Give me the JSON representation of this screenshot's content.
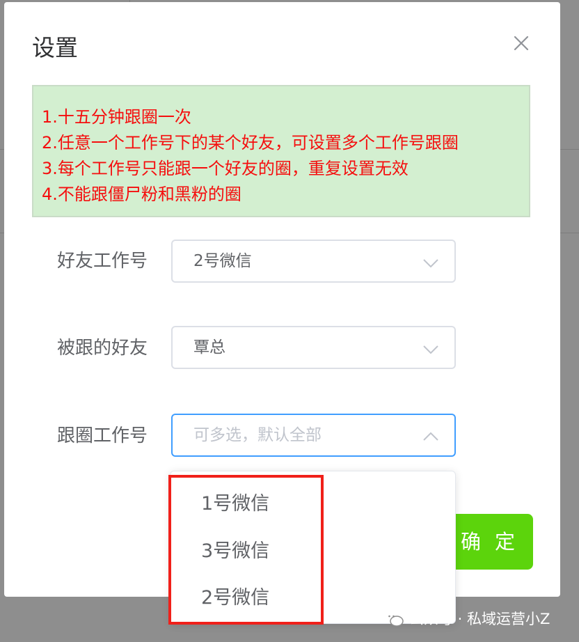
{
  "dialog": {
    "title": "设置",
    "close_icon": "close-icon"
  },
  "notice": {
    "lines": [
      "1.十五分钟跟圈一次",
      "2.任意一个工作号下的某个好友，可设置多个工作号跟圈",
      "3.每个工作号只能跟一个好友的圈，重复设置无效",
      "4.不能跟僵尸粉和黑粉的圈"
    ],
    "text_color": "#f50e0e",
    "background_color": "#d3efd0"
  },
  "form": {
    "friend_account": {
      "label": "好友工作号",
      "value": "2号微信"
    },
    "followed_friend": {
      "label": "被跟的好友",
      "value": "覃总"
    },
    "follow_accounts": {
      "label": "跟圈工作号",
      "placeholder": "可多选，默认全部"
    }
  },
  "dropdown": {
    "options": [
      "1号微信",
      "3号微信",
      "2号微信"
    ]
  },
  "buttons": {
    "confirm_label": "确 定",
    "confirm_color": "#5cd40c"
  },
  "watermark": {
    "text": "公众号 · 私域运营小Z",
    "icon": "wechat-icon"
  }
}
